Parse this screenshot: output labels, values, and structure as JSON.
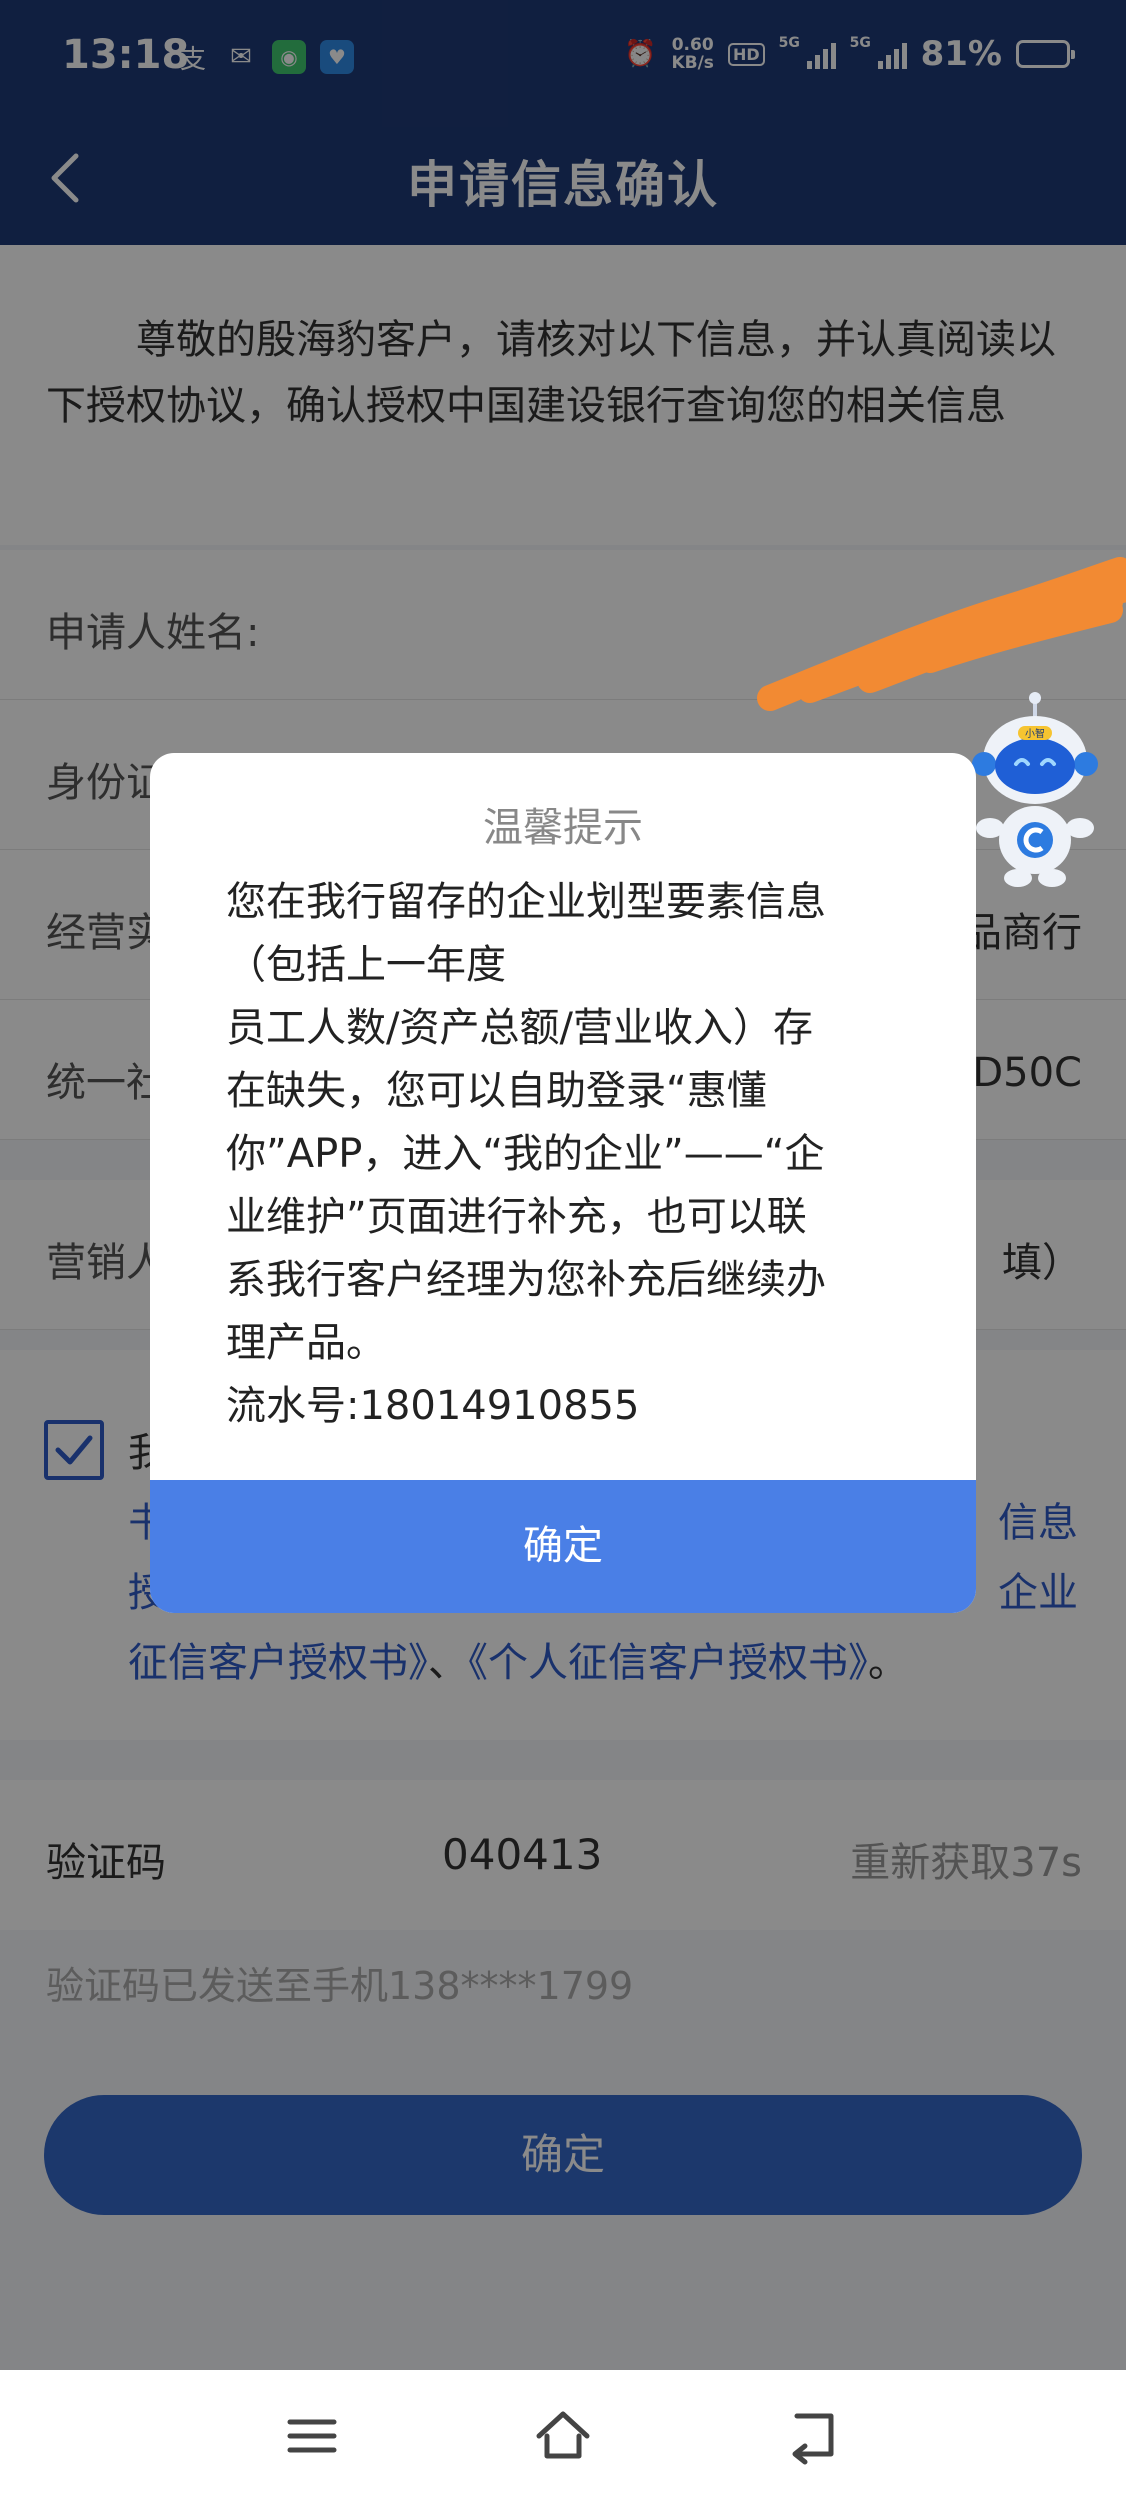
{
  "status_bar": {
    "time": "13:18",
    "net_speed_value": "0.60",
    "net_speed_unit": "KB/s",
    "hd": "HD",
    "sim1": "5G",
    "sim2": "5G",
    "battery": "81%",
    "battery_level": 0.81,
    "app_icons": [
      "alipay-icon",
      "wechat-icon",
      "chat-app-icon",
      "shield-app-icon"
    ]
  },
  "header": {
    "title": "申请信息确认"
  },
  "intro": "尊敬的殷海豹客户，请核对以下信息，并认真阅读以下授权协议，确认授权中国建设银行查询您的相关信息",
  "fields": [
    {
      "label": "申请人姓名:",
      "value": ""
    },
    {
      "label": "身份证",
      "value": ""
    },
    {
      "label": "经营实",
      "value": "品商行"
    },
    {
      "label": "统一社",
      "value": "D50C"
    },
    {
      "label": "营销人",
      "value": "填）"
    }
  ],
  "agreement": {
    "prefix": "我",
    "line2_start": "书",
    "line2_end": "信息",
    "line3_start": "授",
    "line3_end": "企业",
    "line4_link1": "征信客户授权书》",
    "line4_sep": "、",
    "line4_link2": "《个人征信客户授权书》",
    "line4_end": "。"
  },
  "verification": {
    "label": "验证码",
    "code": "040413",
    "resend": "重新获取37s",
    "sent_note": "验证码已发送至手机138****1799"
  },
  "confirm_button": "确定",
  "modal": {
    "title": "温馨提示",
    "lines": [
      "您在我行留存的企业划型要素信息",
      "（包括上一年度",
      "员工人数/资产总额/营业收入）存",
      "在缺失，您可以自助登录“惠懂",
      "你”APP，进入“我的企业”——“企",
      "业维护”页面进行补充，也可以联",
      "系我行客户经理为您补充后继续办",
      "理产品。",
      "流水号:18014910855"
    ],
    "button": "确定"
  },
  "mascot_badge": "小智"
}
